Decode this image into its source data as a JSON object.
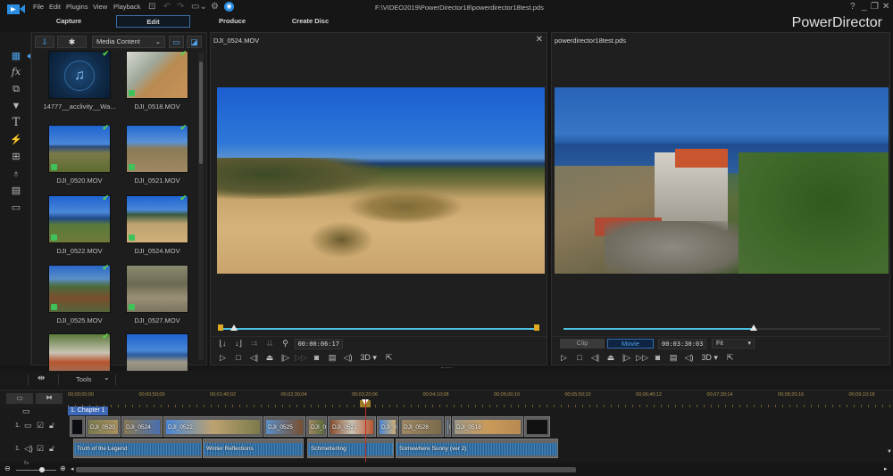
{
  "app": {
    "name": "PowerDirector",
    "file_path": "F:\\VIDEO2019\\PowerDirector18\\powerdirector18test.pds",
    "menu": [
      "File",
      "Edit",
      "Plugins",
      "View",
      "Playback"
    ],
    "window_controls": {
      "help": "?",
      "minimize": "_",
      "restore": "❐",
      "close": "✕"
    }
  },
  "modes": {
    "tabs": [
      {
        "label": "Capture",
        "active": false
      },
      {
        "label": "Edit",
        "active": true
      },
      {
        "label": "Produce",
        "active": false
      },
      {
        "label": "Create Disc",
        "active": false
      }
    ]
  },
  "left_tools": [
    {
      "icon": "media-room-icon",
      "glyph": "▦",
      "selected": true
    },
    {
      "icon": "fx-icon",
      "glyph": "fx"
    },
    {
      "icon": "pip-icon",
      "glyph": "⧉"
    },
    {
      "icon": "particle-icon",
      "glyph": "▼"
    },
    {
      "icon": "title-icon",
      "glyph": "T"
    },
    {
      "icon": "transition-icon",
      "glyph": "⚡"
    },
    {
      "icon": "audio-mixing-icon",
      "glyph": "⊞"
    },
    {
      "icon": "voiceover-icon",
      "glyph": "🎙"
    },
    {
      "icon": "chapter-icon",
      "glyph": "▤"
    },
    {
      "icon": "subtitle-icon",
      "glyph": "▭"
    }
  ],
  "library": {
    "filter": "Media Content",
    "items": [
      {
        "label": "14777__acclivity__Wa...",
        "type": "audio",
        "used": true
      },
      {
        "label": "DJI_0518.MOV",
        "type": "video",
        "used": true
      },
      {
        "label": "DJI_0520.MOV",
        "type": "video",
        "used": true
      },
      {
        "label": "DJI_0521.MOV",
        "type": "video",
        "used": true
      },
      {
        "label": "DJI_0522.MOV",
        "type": "video",
        "used": true
      },
      {
        "label": "DJI_0524.MOV",
        "type": "video",
        "used": true
      },
      {
        "label": "DJI_0525.MOV",
        "type": "video",
        "used": true
      },
      {
        "label": "DJI_0527.MOV",
        "type": "video",
        "used": false
      },
      {
        "label": "",
        "type": "video",
        "used": true
      },
      {
        "label": "",
        "type": "video",
        "used": false
      }
    ]
  },
  "clip_preview": {
    "title": "DJI_0524.MOV",
    "timecode": "00:00:06:17",
    "position": 0.045,
    "three_d_label": "3D"
  },
  "movie_preview": {
    "title": "powerdirector18test.pds",
    "clip_label": "Clip",
    "movie_label": "Movie",
    "timecode": "00:03:30:03",
    "zoom_value": "Fit",
    "position": 0.6,
    "three_d_label": "3D"
  },
  "timeline": {
    "tools_label": "Tools",
    "ruler_ticks": [
      "00;00;00;00",
      "00;00;50;00",
      "00;01;40;02",
      "00;02;30;04",
      "00;03;20;06",
      "00;04;10;08",
      "00;05;00;10",
      "00;05;50;10",
      "00;06;40;12",
      "00;07;30;14",
      "00;08;20;16",
      "00;09;10;18"
    ],
    "chapter_label": "1. Chapter 1",
    "video_track_label": "1.",
    "audio_track_label": "1.",
    "video_clips": [
      "",
      "DJI_0520",
      "DJI_0524",
      "DJI_0522",
      "DJI_0525",
      "DJI_0",
      "DJI_0521",
      "DJI_0",
      "DJI_0528",
      "D",
      "DJI_0518",
      ""
    ],
    "audio_clips": [
      "Truth of the Legend",
      "Winter Reflections",
      "Schmetterling",
      "Somewhere Sunny (ver 2)"
    ]
  }
}
